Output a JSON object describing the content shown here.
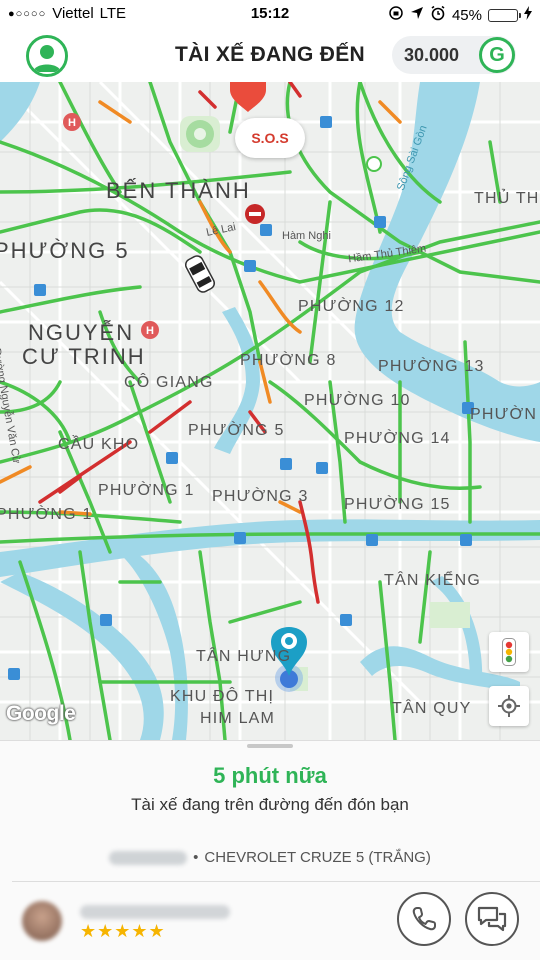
{
  "status_bar": {
    "signal_dots": "●○○○○",
    "carrier": "Viettel",
    "network": "LTE",
    "time": "15:12",
    "battery_percent": "45%",
    "battery_level": 0.45
  },
  "header": {
    "title": "TÀI XẾ ĐANG ĐẾN",
    "credit": "30.000",
    "credit_logo": "G"
  },
  "map": {
    "sos_label": "S.O.S",
    "districts": [
      "BẾN THÀNH",
      "PHƯỜNG 5",
      "NGUYỄN",
      "CƯ TRINH",
      "CÔ GIANG",
      "CẦU KHO",
      "PHƯỜNG 12",
      "PHƯỜNG 8",
      "PHƯỜNG 13",
      "PHƯỜNG 10",
      "PHƯỜNG 14",
      "PHƯỜNG 5",
      "PHƯỜNG 1",
      "PHƯỜNG 3",
      "PHƯỜNG 15",
      "PHƯỜNG 1",
      "TÂN KIỂNG",
      "TÂN HƯNG",
      "KHU ĐÔ THỊ",
      "HIM LAM",
      "TÂN QUY",
      "THỦ THI",
      "PHƯỜN"
    ],
    "streets": [
      "Lê Lai",
      "Hàm Nghi",
      "Hầm Thủ Thiêm",
      "Đường Nguyễn Văn Cừ"
    ],
    "river": "Sông Sài Gòn",
    "attribution": "Google",
    "colors": {
      "road_fast": "#4cc44c",
      "road_slow": "#f08a24",
      "road_jam": "#d32f2f",
      "water": "#9fd7e8",
      "land": "#eef0ee"
    }
  },
  "trip": {
    "eta": "5 phút nữa",
    "eta_subtitle": "Tài xế đang trên đường đến đón bạn",
    "separator": "•",
    "vehicle": "CHEVROLET CRUZE 5 (TRẮNG)",
    "rating_stars": "★★★★★"
  },
  "icons": {
    "avatar": "user-icon",
    "call": "phone-icon",
    "chat": "chat-icon",
    "traffic": "traffic-light-icon",
    "locate": "crosshair-icon"
  }
}
